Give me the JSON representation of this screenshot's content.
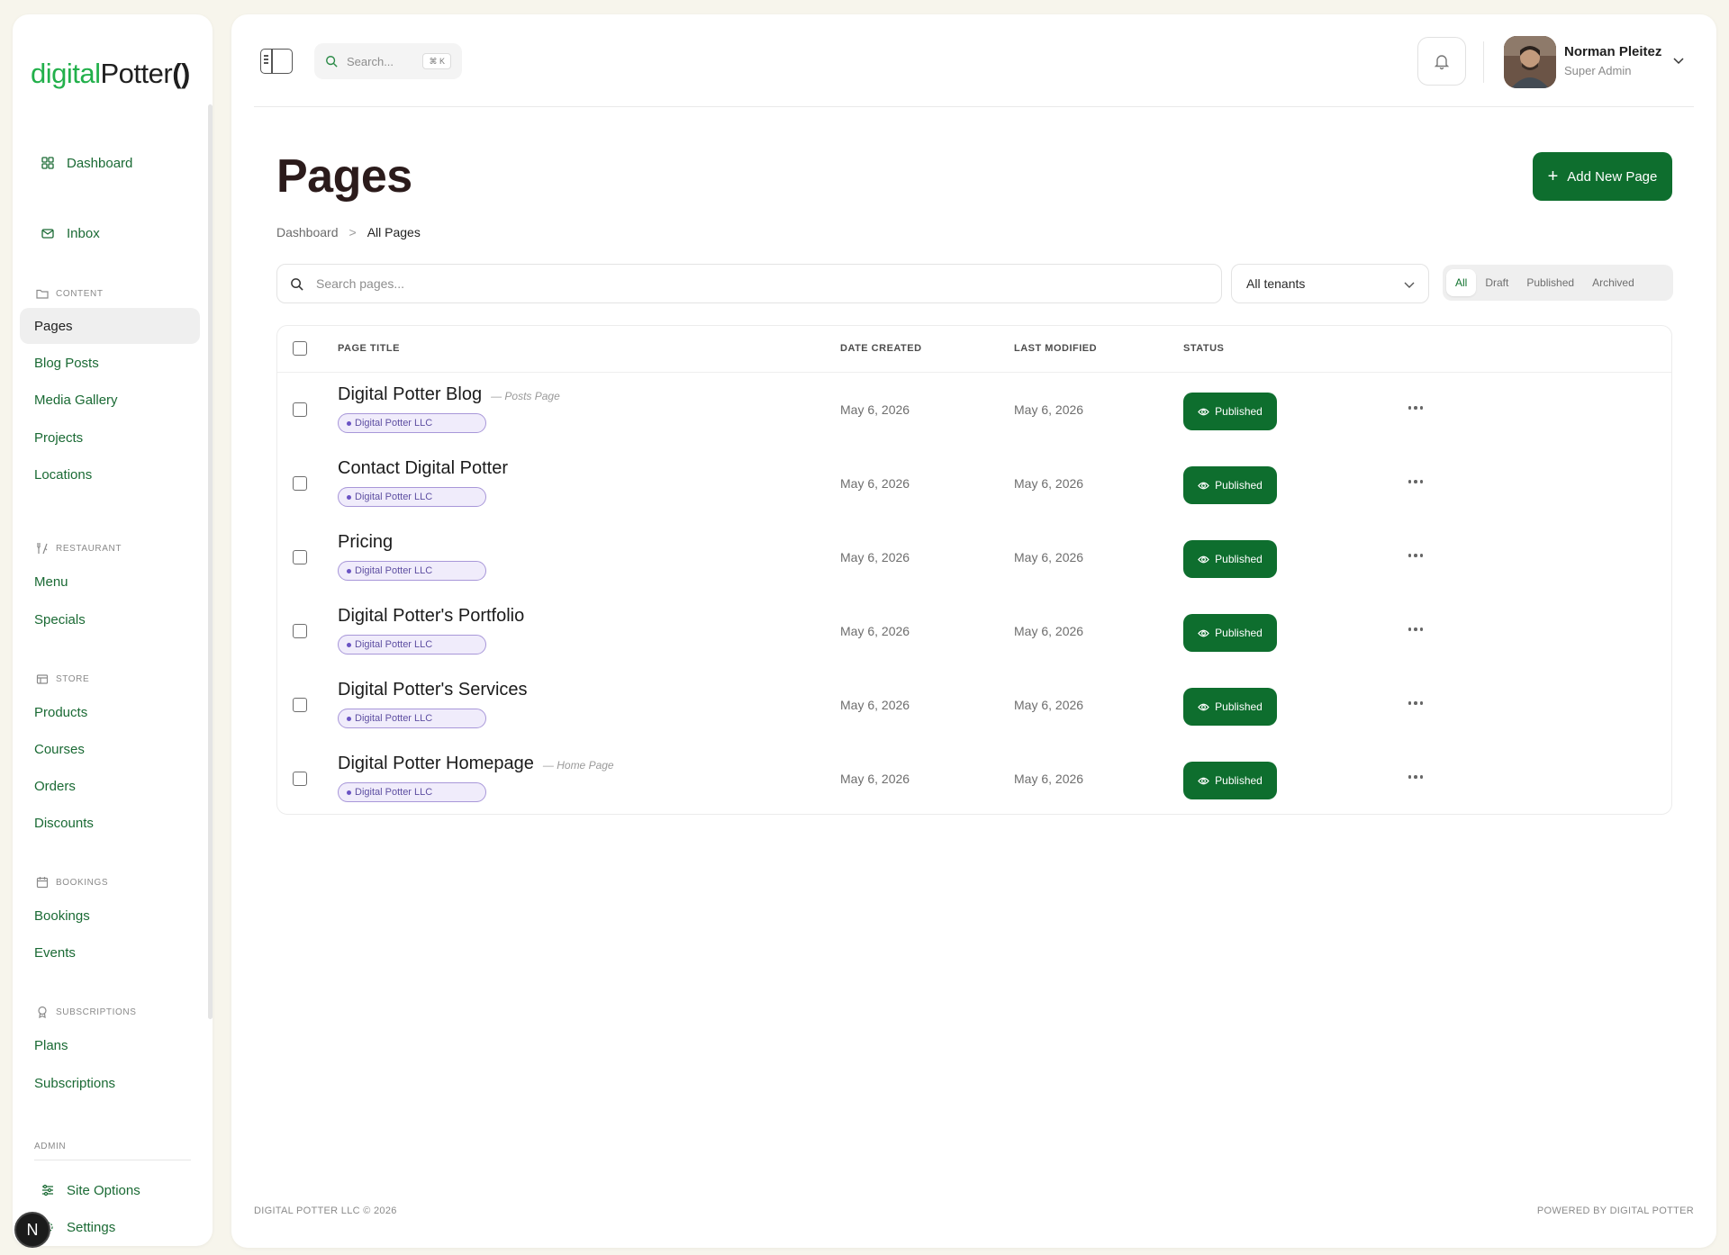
{
  "brand": {
    "part1": "digital",
    "part2": "Potter",
    "part3": "()"
  },
  "sidebar": {
    "top_items": [
      {
        "label": "Dashboard",
        "icon": "grid-icon"
      },
      {
        "label": "Inbox",
        "icon": "mail-icon"
      }
    ],
    "sections": [
      {
        "label": "CONTENT",
        "icon": "folder-icon",
        "items": [
          "Pages",
          "Blog Posts",
          "Media Gallery",
          "Projects",
          "Locations"
        ]
      },
      {
        "label": "RESTAURANT",
        "icon": "utensils-icon",
        "items": [
          "Menu",
          "Specials"
        ]
      },
      {
        "label": "STORE",
        "icon": "store-icon",
        "items": [
          "Products",
          "Courses",
          "Orders",
          "Discounts"
        ]
      },
      {
        "label": "BOOKINGS",
        "icon": "calendar-icon",
        "items": [
          "Bookings",
          "Events"
        ]
      },
      {
        "label": "SUBSCRIPTIONS",
        "icon": "badge-icon",
        "items": [
          "Plans",
          "Subscriptions"
        ]
      },
      {
        "label": "ADMIN",
        "icon": "",
        "items": [
          "Site Options",
          "Settings"
        ]
      }
    ],
    "active_item": "Pages",
    "next_badge": "N"
  },
  "topbar": {
    "search_placeholder": "Search...",
    "search_shortcut": "⌘ K",
    "user": {
      "name": "Norman Pleitez",
      "role": "Super Admin"
    }
  },
  "page": {
    "title": "Pages",
    "add_button": "Add New Page",
    "breadcrumb": {
      "parent": "Dashboard",
      "separator": ">",
      "current": "All Pages"
    }
  },
  "filters": {
    "search_placeholder": "Search pages...",
    "tenant_value": "All tenants",
    "status_tabs": [
      "All",
      "Draft",
      "Published",
      "Archived"
    ],
    "active_status_tab": "All"
  },
  "table": {
    "columns": [
      "PAGE TITLE",
      "DATE CREATED",
      "LAST MODIFIED",
      "STATUS"
    ],
    "rows": [
      {
        "title": "Digital Potter Blog",
        "note": "— Posts Page",
        "tenant": "Digital Potter LLC",
        "created": "May 6, 2026",
        "modified": "May 6, 2026",
        "status": "Published"
      },
      {
        "title": "Contact Digital Potter",
        "note": "",
        "tenant": "Digital Potter LLC",
        "created": "May 6, 2026",
        "modified": "May 6, 2026",
        "status": "Published"
      },
      {
        "title": "Pricing",
        "note": "",
        "tenant": "Digital Potter LLC",
        "created": "May 6, 2026",
        "modified": "May 6, 2026",
        "status": "Published"
      },
      {
        "title": "Digital Potter's Portfolio",
        "note": "",
        "tenant": "Digital Potter LLC",
        "created": "May 6, 2026",
        "modified": "May 6, 2026",
        "status": "Published"
      },
      {
        "title": "Digital Potter's Services",
        "note": "",
        "tenant": "Digital Potter LLC",
        "created": "May 6, 2026",
        "modified": "May 6, 2026",
        "status": "Published"
      },
      {
        "title": "Digital Potter Homepage",
        "note": "— Home Page",
        "tenant": "Digital Potter LLC",
        "created": "May 6, 2026",
        "modified": "May 6, 2026",
        "status": "Published"
      }
    ]
  },
  "footer": {
    "left": "DIGITAL POTTER LLC © 2026",
    "right": "POWERED BY DIGITAL POTTER"
  },
  "colors": {
    "brand_green": "#22b04b",
    "primary": "#0e6e2e",
    "nav_text": "#1a6a34",
    "chip_purple": "#5e4fa2"
  }
}
